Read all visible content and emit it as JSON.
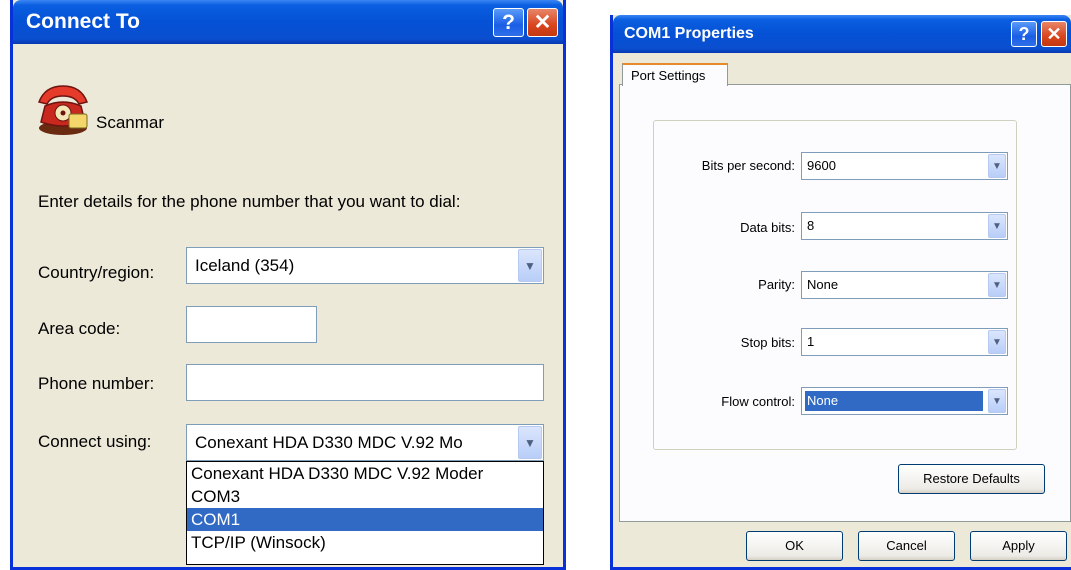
{
  "connect_to": {
    "title": "Connect To",
    "connection_name": "Scanmar",
    "prompt": "Enter details for the phone number that you want to dial:",
    "country_label": "Country/region:",
    "country_value": "Iceland (354)",
    "area_code_label": "Area code:",
    "area_code_value": "",
    "phone_label": "Phone number:",
    "phone_value": "",
    "connect_using_label": "Connect using:",
    "connect_using_value": "Conexant HDA D330 MDC V.92 Mo",
    "connect_using_options": [
      "Conexant HDA D330 MDC V.92 Moder",
      "COM3",
      "COM1",
      "TCP/IP (Winsock)"
    ],
    "selected_option": "COM1"
  },
  "com1_properties": {
    "title": "COM1 Properties",
    "tab_label": "Port Settings",
    "bits_per_second_label": "Bits per second:",
    "bits_per_second_value": "9600",
    "data_bits_label": "Data bits:",
    "data_bits_value": "8",
    "parity_label": "Parity:",
    "parity_value": "None",
    "stop_bits_label": "Stop bits:",
    "stop_bits_value": "1",
    "flow_control_label": "Flow control:",
    "flow_control_value": "None",
    "restore_defaults_label": "Restore Defaults",
    "ok_label": "OK",
    "cancel_label": "Cancel",
    "apply_label": "Apply"
  },
  "titlebar_buttons": {
    "help_glyph": "?",
    "close_glyph": "✕"
  },
  "colors": {
    "titlebar_blue": "#0551d6",
    "window_face": "#ece9d8",
    "selection": "#316ac5",
    "tab_accent": "#e68b2c"
  },
  "icons": {
    "dropdown_arrow": "chevron-down-icon",
    "connection_icon": "telephone-icon"
  }
}
